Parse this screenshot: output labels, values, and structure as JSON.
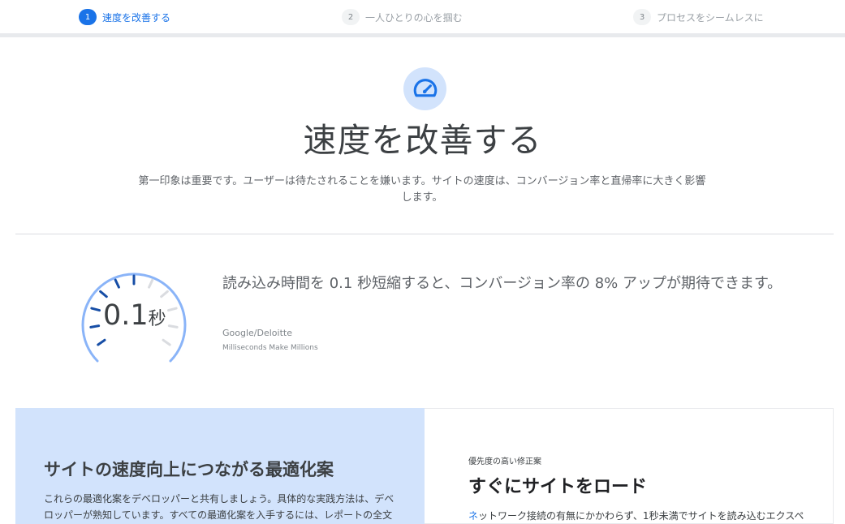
{
  "stepper": {
    "steps": [
      {
        "number": "1",
        "label": "速度を改善する"
      },
      {
        "number": "2",
        "label": "一人ひとりの心を掴む"
      },
      {
        "number": "3",
        "label": "プロセスをシームレスに"
      }
    ]
  },
  "hero": {
    "icon": "speedometer-icon",
    "title": "速度を改善する",
    "description": "第一印象は重要です。ユーザーは待たされることを嫌います。サイトの速度は、コンバージョン率と直帰率に大きく影響します。"
  },
  "stat": {
    "gauge_value": "0.1",
    "gauge_unit": "秒",
    "text": "読み込み時間を 0.1 秒短縮すると、コンバージョン率の 8% アップが期待できます。",
    "source": "Google/Deloitte",
    "source_title": "Milliseconds Make Millions"
  },
  "card_left": {
    "title": "サイトの速度向上につながる最適化案",
    "description": "これらの最適化案をデベロッパーと共有しましょう。具体的な実践方法は、デベロッパーが熟知しています。すべての最適化案を入手するには、レポートの全文をダウンロードしてください。"
  },
  "card_right": {
    "eyebrow": "優先度の高い修正案",
    "title": "すぐにサイトをロード",
    "link_text": "ネ",
    "description": "ットワーク接続の有無にかかわらず、1秒未満でサイトを読み込むエクスペ"
  },
  "colors": {
    "accent": "#1a73e8",
    "accent_light": "#d2e3fc",
    "gauge_ring": "#8ab4f8",
    "gauge_tick_dark": "#174ea6",
    "gauge_tick_light": "#dadce0"
  }
}
